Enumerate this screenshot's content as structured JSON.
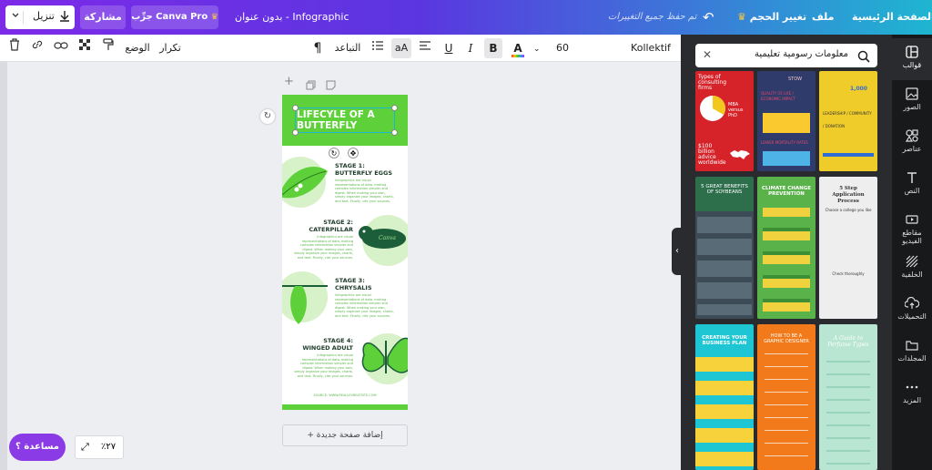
{
  "topbar": {
    "home": "الصفحة الرئيسية",
    "file": "ملف",
    "resize": "تغيير الحجم",
    "saved_status": "تم حفظ جميع التغييرات",
    "doc_title": "بدون عنوان - Infographic",
    "try_pro": "جرِّب Canva Pro",
    "share": "مشاركة",
    "download": "تنزيل"
  },
  "toolbar": {
    "font_name": "Kollektif",
    "font_size": "60",
    "case_label": "aA",
    "spacing": "التباعد",
    "position": "الوضع",
    "duplicate": "تكرار"
  },
  "canvas": {
    "add_page": "+ إضافة صفحة جديدة",
    "zoom": "٪٢٧",
    "help": "مساعدة ؟"
  },
  "infographic": {
    "title": "LIFECYLE OF A BUTTERFLY",
    "stage1_title": "STAGE 1:\nBUTTERFLY EGGS",
    "stage2_title": "STAGE 2:\nCATERPILLAR",
    "stage3_title": "STAGE 3:\nCHRYSALIS",
    "stage4_title": "STAGE 4:\nWINGED ADULT",
    "body_text": "Infographics are visual representations of data, making complex information simpler and digest. When making your own, simply organize your images, charts, and text. Finally, cite your sources.",
    "caterpillar_label": "Canva",
    "source": "SOURCE: WWW.REALLYGREATSITE.COM"
  },
  "panel": {
    "search_value": "معلومات رسومية تعليمية",
    "templates": [
      {
        "title": "Types of consulting firms",
        "sub": "MBA versus PhD",
        "stat": "$100 billion advice worldwide",
        "bg": "#d6232a"
      },
      {
        "title": "STOW",
        "sub": "QUALITY OF LIFE / ECONOMIC IMPACT",
        "stat": "LOWER MORTALITY RATES",
        "bg": "#2f3c6b"
      },
      {
        "title": "1,000",
        "sub": "LEADERSHIP / COMMUNITY / DONATION",
        "stat": "",
        "bg": "#f0cc2a"
      },
      {
        "title": "5 GREAT BENEFITS OF SOYBEANS",
        "sub": "",
        "stat": "",
        "bg": "#3d4b57"
      },
      {
        "title": "CLIMATE CHANGE PREVENTION",
        "sub": "",
        "stat": "",
        "bg": "#5ab34a"
      },
      {
        "title": "5 Step Application Process",
        "sub": "Choose a college you like",
        "stat": "Check thoroughly",
        "bg": "#eeeeee"
      },
      {
        "title": "CREATING YOUR BUSINESS PLAN",
        "sub": "",
        "stat": "",
        "bg": "#1ec6d4"
      },
      {
        "title": "HOW TO BE A GRAPHIC DESIGNER",
        "sub": "",
        "stat": "",
        "bg": "#f27a1a"
      },
      {
        "title": "A Guide to Perfume Types",
        "sub": "",
        "stat": "",
        "bg": "#b9e6d2"
      }
    ]
  },
  "sidenav": [
    {
      "label": "قوالب",
      "icon": "templates-icon"
    },
    {
      "label": "الصور",
      "icon": "photos-icon"
    },
    {
      "label": "عناصر",
      "icon": "elements-icon"
    },
    {
      "label": "النص",
      "icon": "text-icon"
    },
    {
      "label": "مقاطع الفيديو",
      "icon": "video-icon"
    },
    {
      "label": "الخلفية",
      "icon": "background-icon"
    },
    {
      "label": "التحميلات",
      "icon": "uploads-icon"
    },
    {
      "label": "المجلدات",
      "icon": "folders-icon"
    },
    {
      "label": "المزيد",
      "icon": "more-icon"
    }
  ],
  "colors": {
    "accent": "#7d2ae8",
    "brand_green": "#5ed13a",
    "teal": "#1fb5d1"
  }
}
